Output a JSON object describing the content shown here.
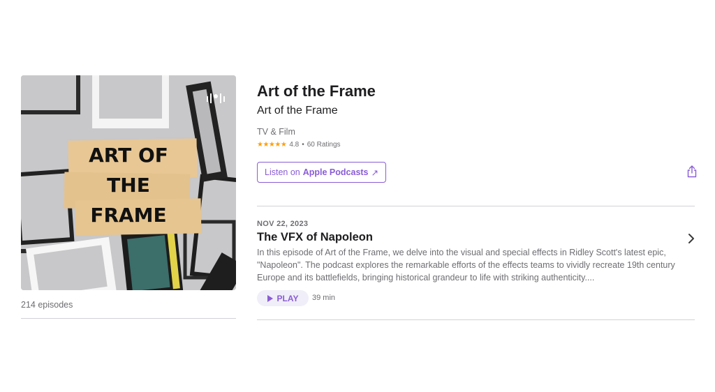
{
  "podcast": {
    "artwork_text": [
      "ART OF",
      "THE",
      "FRAME"
    ],
    "episode_count": "214 episodes",
    "title": "Art of the Frame",
    "author": "Art of the Frame",
    "category": "TV & Film",
    "rating": {
      "stars": "★★★★★",
      "value": "4.8",
      "separator": "•",
      "count": "60 Ratings"
    },
    "listen_prefix": "Listen on",
    "listen_app": "Apple Podcasts",
    "listen_arrow": "↗"
  },
  "episode": {
    "date": "NOV 22, 2023",
    "title": "The VFX of Napoleon",
    "description": "In this episode of Art of the Frame, we delve into the visual and special effects in Ridley Scott's latest epic, \"Napoleon\". The podcast explores the remarkable efforts of the effects teams to vividly recreate 19th century Europe and its battlefields, bringing historical grandeur to life with striking authenticity....",
    "play_label": "PLAY",
    "duration": "39 min"
  },
  "colors": {
    "accent": "#8a5cd6",
    "star": "#ff9f0a",
    "secondary_text": "#6e6e73"
  }
}
